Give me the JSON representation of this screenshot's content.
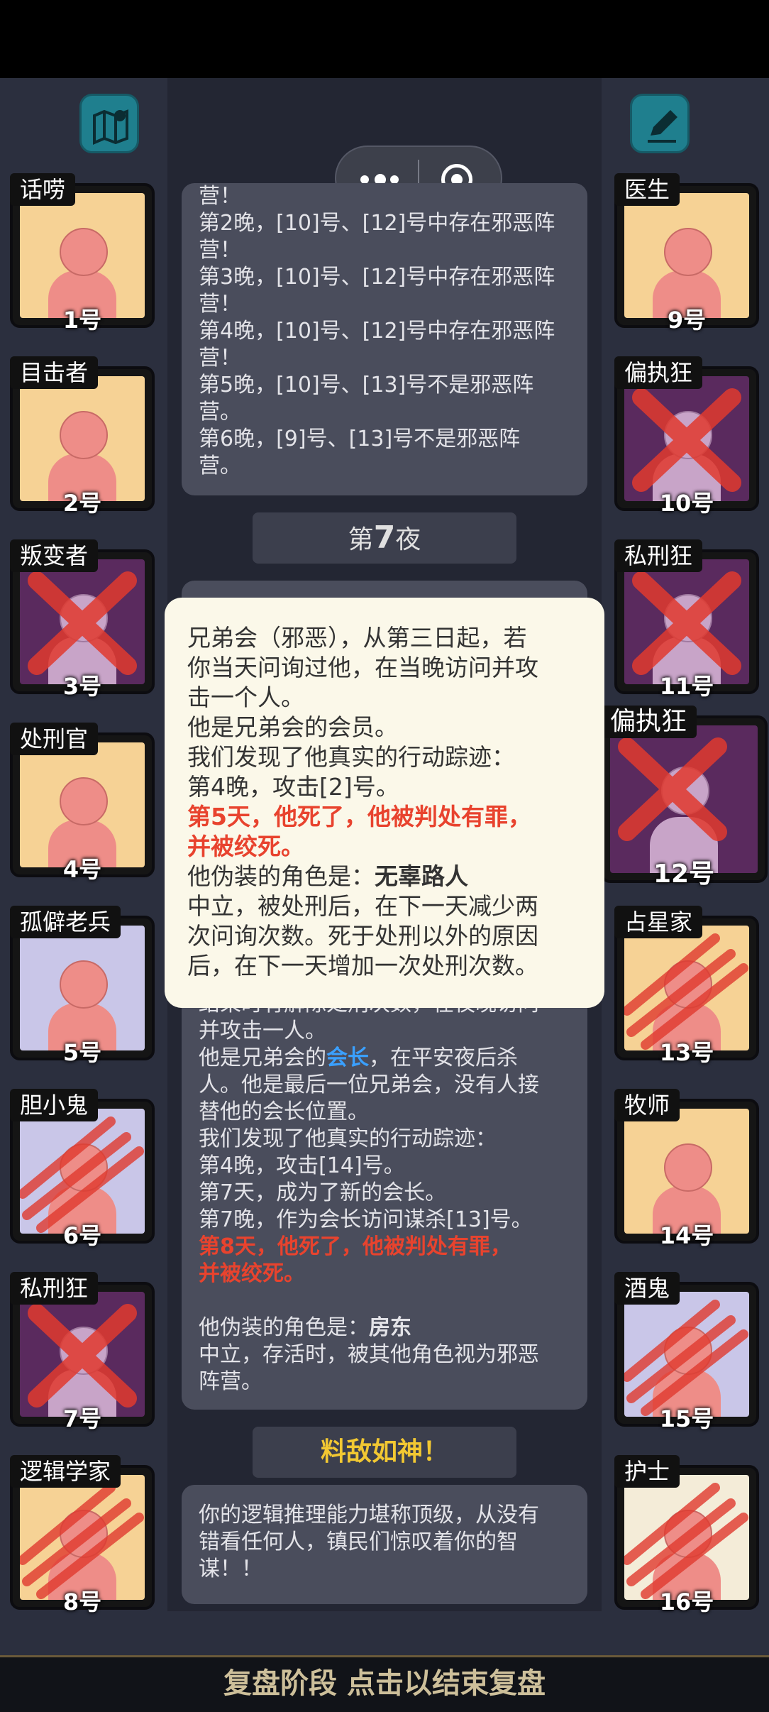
{
  "left_cards": [
    {
      "role": "话唠",
      "number": "1号",
      "state": "alive",
      "bg": "yellow"
    },
    {
      "role": "目击者",
      "number": "2号",
      "state": "alive",
      "bg": "yellow"
    },
    {
      "role": "叛变者",
      "number": "3号",
      "state": "executed",
      "bg": "purple"
    },
    {
      "role": "处刑官",
      "number": "4号",
      "state": "alive",
      "bg": "yellow"
    },
    {
      "role": "孤僻老兵",
      "number": "5号",
      "state": "alive",
      "bg": "lav"
    },
    {
      "role": "胆小鬼",
      "number": "6号",
      "state": "killed",
      "bg": "lav"
    },
    {
      "role": "私刑狂",
      "number": "7号",
      "state": "executed",
      "bg": "purple"
    },
    {
      "role": "逻辑学家",
      "number": "8号",
      "state": "killed",
      "bg": "yellow"
    }
  ],
  "right_cards": [
    {
      "role": "医生",
      "number": "9号",
      "state": "alive",
      "bg": "yellow"
    },
    {
      "role": "偏执狂",
      "number": "10号",
      "state": "executed",
      "bg": "purple"
    },
    {
      "role": "私刑狂",
      "number": "11号",
      "state": "executed",
      "bg": "purple"
    },
    {
      "role": "偏执狂",
      "number": "12号",
      "state": "executed",
      "bg": "purple"
    },
    {
      "role": "占星家",
      "number": "13号",
      "state": "killed",
      "bg": "yellow"
    },
    {
      "role": "牧师",
      "number": "14号",
      "state": "alive",
      "bg": "yellow"
    },
    {
      "role": "酒鬼",
      "number": "15号",
      "state": "killed",
      "bg": "lav"
    },
    {
      "role": "护士",
      "number": "16号",
      "state": "killed",
      "bg": "white"
    }
  ],
  "icons": {
    "map": "map-pin-icon",
    "edit": "pencil-icon",
    "more": "more-dots-icon",
    "close": "record-target-icon"
  },
  "log_panel_1": [
    "营！",
    "第2晚，[10]号、[12]号中存在邪恶阵",
    "营！",
    "第3晚，[10]号、[12]号中存在邪恶阵",
    "营！",
    "第4晚，[10]号、[12]号中存在邪恶阵",
    "营！",
    "第5晚，[10]号、[13]号不是邪恶阵",
    "营。",
    "第6晚，[9]号、[13]号不是邪恶阵",
    "营。"
  ],
  "night_label_prefix": "第",
  "night_label_number": "7",
  "night_label_suffix": "夜",
  "popup": {
    "line1": "兄弟会（邪恶），从第三日起，若",
    "line2": "你当天问询过他，在当晚访问并攻",
    "line3": "击一个人。",
    "line4": "他是兄弟会的会员。",
    "line5": "我们发现了他真实的行动踪迹：",
    "line6": "第4晚，攻击[2]号。",
    "red1": "第5天，他死了，他被判处有罪，",
    "red2": "并被绞死。",
    "disguise_label": "他伪装的角色是：",
    "disguise_role": "无辜路人",
    "line9": "中立，被处刑后，在下一天减少两",
    "line10": "次问询次数。死于处刑以外的原因",
    "line11": "后，在下一天增加一次处刑次数。"
  },
  "log_panel_2": {
    "cut": "结束时有解除处刑次数，在夜晚访问",
    "l1": "并攻击一人。",
    "l2a": "他是兄弟会的",
    "l2b": "会长",
    "l2c": "，在平安夜后杀",
    "l3": "人。他是最后一位兄弟会，没有人接",
    "l4": "替他的会长位置。",
    "l5": "我们发现了他真实的行动踪迹：",
    "l6": "第4晚，攻击[14]号。",
    "l7": "第7天，成为了新的会长。",
    "l8": "第7晚，作为会长访问谋杀[13]号。",
    "red1": "第8天，他死了，他被判处有罪，",
    "red2": "并被绞死。",
    "disguise_label": "他伪装的角色是：",
    "disguise_role": "房东",
    "l10": "中立，存活时，被其他角色视为邪恶",
    "l11": "阵营。"
  },
  "result_title": "料敌如神！",
  "result_text": [
    "你的逻辑推理能力堪称顶级，从没有",
    "错看任何人，镇民们惊叹着你的智",
    "谋！！"
  ],
  "bottom_bar": "复盘阶段 点击以结束复盘",
  "colors": {
    "red_text": "#e8432e",
    "gold": "#f2c832",
    "teal_button": "#1f7f8e",
    "blue_link": "#3aa0ff"
  }
}
